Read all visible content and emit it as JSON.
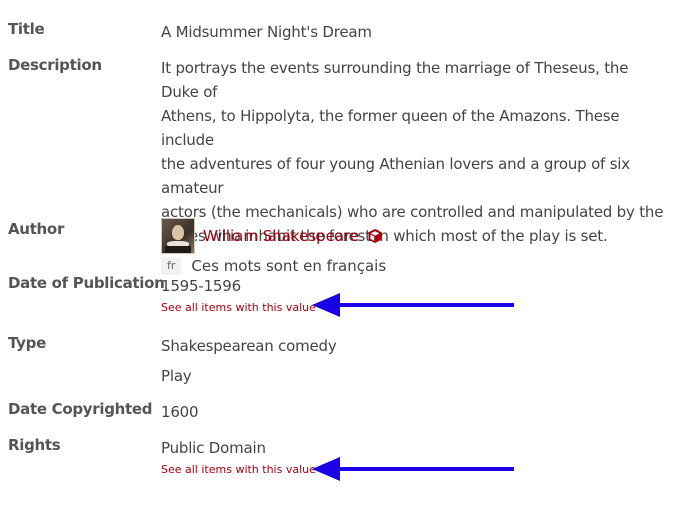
{
  "fields": {
    "title": {
      "label": "Title",
      "value": "A Midsummer Night's Dream"
    },
    "description": {
      "label": "Description",
      "value": "It portrays the events surrounding the marriage of Theseus, the Duke of Athens, to Hippolyta, the former queen of the Amazons. These include the adventures of four young Athenian lovers and a group of six amateur actors (the mechanicals) who are controlled and manipulated by the fairies who inhabit the forest in which most of the play is set.",
      "lines": [
        "It portrays the events surrounding the marriage of Theseus, the Duke of",
        "Athens, to Hippolyta, the former queen of the Amazons. These include",
        "the adventures of four young Athenian lovers and a group of six amateur",
        "actors (the mechanicals) who are controlled and manipulated by the",
        "fairies who inhabit the forest in which most of the play is set."
      ],
      "lang_code": "fr",
      "lang_value": "Ces mots sont en français"
    },
    "author": {
      "label": "Author",
      "value": "William Shakespeare",
      "icon": "resource-cube-icon",
      "avatar": "portrait-thumbnail"
    },
    "date_of_publication": {
      "label": "Date of Publication",
      "value": "1595-1596",
      "see_all": "See all items with this value"
    },
    "type": {
      "label": "Type",
      "values": [
        "Shakespearean comedy",
        "Play"
      ]
    },
    "date_copyrighted": {
      "label": "Date Copyrighted",
      "value": "1600"
    },
    "rights": {
      "label": "Rights",
      "value": "Public Domain",
      "see_all": "See all items with this value"
    }
  },
  "colors": {
    "link": "#a3000f",
    "annotation_arrow": "#1a00e6",
    "label": "#555555",
    "text": "#444444"
  }
}
